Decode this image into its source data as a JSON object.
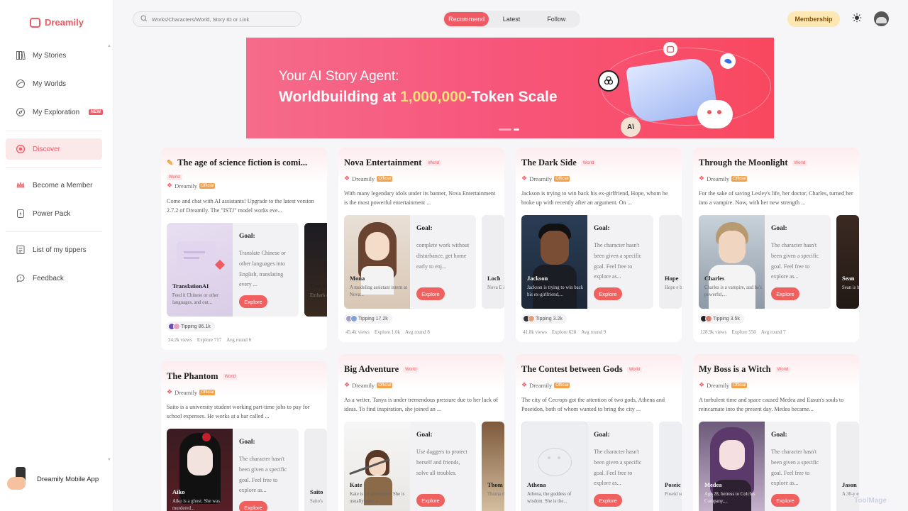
{
  "app": {
    "name": "Dreamily"
  },
  "sidebar": {
    "items": [
      {
        "label": "My Stories",
        "icon": "book-icon"
      },
      {
        "label": "My Worlds",
        "icon": "globe-icon"
      },
      {
        "label": "My Exploration",
        "icon": "compass-icon",
        "badge": "NEW"
      },
      {
        "label": "Discover",
        "icon": "discover-icon",
        "active": true
      },
      {
        "label": "Become a Member",
        "icon": "crown-icon"
      },
      {
        "label": "Power Pack",
        "icon": "lightning-icon"
      },
      {
        "label": "List of my tippers",
        "icon": "list-icon"
      },
      {
        "label": "Feedback",
        "icon": "chat-icon"
      }
    ],
    "mobile_app": "Dreamily Mobile App"
  },
  "header": {
    "search_placeholder": "Works/Characters/World, Story ID or Link",
    "tabs": [
      {
        "label": "Recommend",
        "active": true
      },
      {
        "label": "Latest"
      },
      {
        "label": "Follow"
      }
    ],
    "membership": "Membership"
  },
  "banner": {
    "line1": "Your AI Story Agent:",
    "line2_pre": "Worldbuilding at ",
    "line2_highlight": "1,000,000",
    "line2_post": "-Token Scale"
  },
  "common": {
    "world": "World",
    "author": "Dreamily",
    "official": "Official",
    "goal": "Goal:",
    "explore": "Explore"
  },
  "cards": [
    {
      "title": "The age of science fiction is comi...",
      "desc": "Come and chat with AI assistants! Upgrade to the latest version 2.7.2 of Dreamily. The \"ISTJ\" model works eve...",
      "char_name": "TranslationAI",
      "char_desc": "Feed it Chinese or other languages, and out...",
      "goal_text": "Translate Chinese or other languages into English, translating every ...",
      "char2_name": "TextA",
      "char2_desc": "Embark quest w",
      "tipping": "Tipping 86.1k",
      "views": "24.2k views",
      "explore_count": "Explore 717",
      "avg_round": "Avg round 6"
    },
    {
      "title": "Nova Entertainment",
      "desc": "With many legendary idols under its banner, Nova Entertainment is the most powerful entertainment ...",
      "char_name": "Mona",
      "char_desc": "A modeling assistant intern at Nova...",
      "goal_text": "complete work without disturbance, get home early to enj...",
      "char2_name": "Loch",
      "char2_desc": "Nova E idol. He",
      "tipping": "Tipping 17.2k",
      "views": "45.4k views",
      "explore_count": "Explore 1.0k",
      "avg_round": "Avg round 8"
    },
    {
      "title": "The Dark Side",
      "desc": "Jackson is trying to win back his ex-girlfriend, Hope, whom he broke up with recently after an argument. On ...",
      "char_name": "Jackson",
      "char_desc": "Jackson is trying to win back his ex-girlfriend,...",
      "goal_text": "The character hasn't been given a specific goal. Feel free to explore as...",
      "char2_name": "Hope",
      "char2_desc": "Hope e books a",
      "tipping": "Tipping 3.2k",
      "views": "41.8k views",
      "explore_count": "Explore 628",
      "avg_round": "Avg round 9"
    },
    {
      "title": "Through the Moonlight",
      "desc": "For the sake of saving Lesley's life, her doctor, Charles, turned her into a vampire. Now, with her new strength ...",
      "char_name": "Charles",
      "char_desc": "Charles is a vampire, and he's powerful,...",
      "goal_text": "The character hasn't been given a specific goal. Feel free to explore as...",
      "char2_name": "Sean",
      "char2_desc": "Sean is hunter.",
      "tipping": "Tipping 3.5k",
      "views": "128.9k views",
      "explore_count": "Explore 550",
      "avg_round": "Avg round 7"
    },
    {
      "title": "The Phantom",
      "desc": "Saito is a university student working part-time jobs to pay for school expenses. He works at a bar called ...",
      "char_name": "Aiko",
      "char_desc": "Aiko is a ghost. She was murdered...",
      "goal_text": "The character hasn't been given a specific goal. Feel free to explore as...",
      "char2_name": "Saito",
      "char2_desc": "Saito's"
    },
    {
      "title": "Big Adventure",
      "desc": "As a writer, Tanya is under tremendous pressure due to her lack of ideas. To find inspiration, she joined an ...",
      "char_name": "Kate",
      "char_desc": "Kate is an adventurer. She is usually quiet a...",
      "goal_text": "Use daggers to protect herself and friends, solve all troubles.",
      "char2_name": "Thom",
      "char2_desc": "Thoma doesn't"
    },
    {
      "title": "The Contest between Gods",
      "desc": "The city of Cecrops got the attention of two gods, Athena and Poseidon, both of whom wanted to bring the city ...",
      "char_name": "Athena",
      "char_desc": "Athena, the goddess of wisdom. She is the...",
      "goal_text": "The character hasn't been given a specific goal. Feel free to explore as...",
      "char2_name": "Poseic",
      "char2_desc": "Poseid sea. He"
    },
    {
      "title": "My Boss is a Witch",
      "desc": "A turbulent time and space caused Medea and Easun's souls to reincarnate into the present day. Medea became...",
      "char_name": "Medea",
      "char_desc": "Age 28, heiress to Colchis Company,...",
      "goal_text": "The character hasn't been given a specific goal. Feel free to explore as...",
      "char2_name": "Jason",
      "char2_desc": "A 30-y emplo"
    }
  ],
  "watermark": "ToolMage"
}
